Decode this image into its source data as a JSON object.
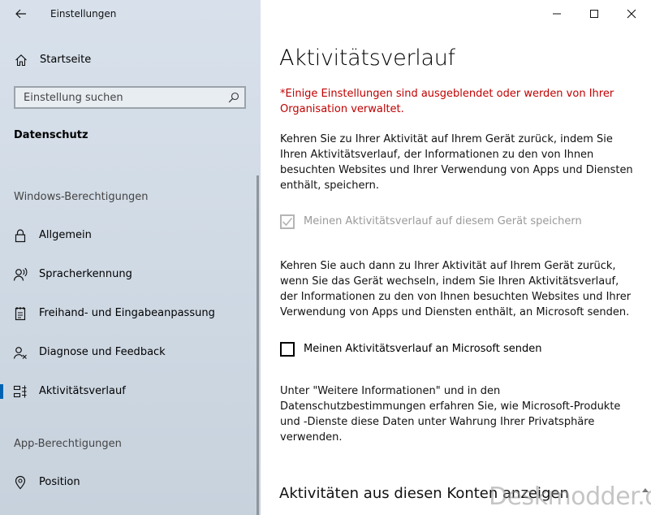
{
  "window": {
    "app_title": "Einstellungen"
  },
  "sidebar": {
    "home_label": "Startseite",
    "search_placeholder": "Einstellung suchen",
    "section_title": "Datenschutz",
    "group1_header": "Windows-Berechtigungen",
    "items": [
      {
        "label": "Allgemein",
        "icon": "lock-icon"
      },
      {
        "label": "Spracherkennung",
        "icon": "speech-icon"
      },
      {
        "label": "Freihand- und Eingabeanpassung",
        "icon": "notepad-icon"
      },
      {
        "label": "Diagnose und Feedback",
        "icon": "feedback-person-icon"
      },
      {
        "label": "Aktivitätsverlauf",
        "icon": "activity-history-icon",
        "selected": true
      }
    ],
    "group2_header": "App-Berechtigungen",
    "items2": [
      {
        "label": "Position",
        "icon": "location-icon"
      }
    ]
  },
  "main": {
    "title": "Aktivitätsverlauf",
    "warning": "*Einige Einstellungen sind ausgeblendet oder werden von Ihrer Organisation verwaltet.",
    "para1": "Kehren Sie zu Ihrer Aktivität auf Ihrem Gerät zurück, indem Sie Ihren Aktivitätsverlauf, der Informationen zu den von Ihnen besuchten Websites und Ihrer Verwendung von Apps und Diensten enthält, speichern.",
    "checkbox1": {
      "label": "Meinen Aktivitätsverlauf auf diesem Gerät speichern",
      "checked": true,
      "disabled": true
    },
    "para2": "Kehren Sie auch dann zu Ihrer Aktivität auf Ihrem Gerät zurück, wenn Sie das Gerät wechseln, indem Sie Ihren Aktivitätsverlauf, der Informationen zu den von Ihnen besuchten Websites und Ihrer Verwendung von Apps und Diensten enthält, an Microsoft senden.",
    "checkbox2": {
      "label": "Meinen Aktivitätsverlauf an Microsoft senden",
      "checked": false,
      "disabled": false
    },
    "para3": "Unter \"Weitere Informationen\" und in den Datenschutzbestimmungen erfahren Sie, wie Microsoft-Produkte und -Dienste diese Daten unter Wahrung Ihrer Privatsphäre verwenden.",
    "sub_heading": "Aktivitäten aus diesen Konten anzeigen"
  },
  "watermark": "Deskmodder.de",
  "colors": {
    "accent": "#0063b1",
    "warning": "#c00000",
    "sidebar_bg": "#d3dde8"
  }
}
